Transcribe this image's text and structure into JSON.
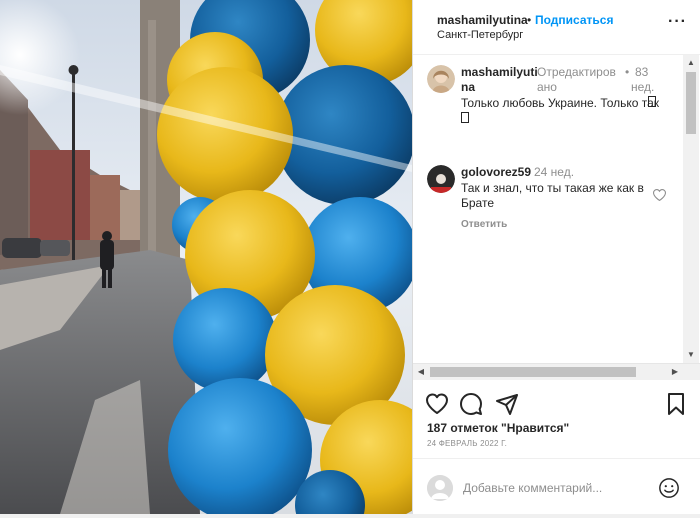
{
  "post": {
    "username": "mashamilyutina",
    "dot": "•",
    "follow_label": "Подписаться",
    "location": "Санкт-Петербург",
    "more_icon": "more-dots-icon"
  },
  "comments": [
    {
      "username_line1": "mashamilyuti",
      "username_line2": "na",
      "edited_line1": "Отредактиров",
      "edited_line2": "ано",
      "dot": "•",
      "age_line1": "83",
      "age_line2": "нед.",
      "text_line1": "Только любовь Украине. Только так",
      "text_line2": "",
      "avatar_icon": "user-avatar-icon"
    },
    {
      "username": "golovorez59",
      "age": "24 нед.",
      "text_line1": "Так и знал, что ты такая же как в",
      "text_line2": "Брате",
      "reply_label": "Ответить",
      "like_icon": "heart-outline-icon",
      "avatar_icon": "user-avatar-icon"
    }
  ],
  "actions": {
    "like_icon": "heart-icon",
    "comment_icon": "comment-icon",
    "share_icon": "share-icon",
    "save_icon": "bookmark-icon"
  },
  "likes_text": "187 отметок \"Нравится\"",
  "date_text": "24 ФЕВРАЛЬ 2022 Г.",
  "add_comment": {
    "placeholder": "Добавьте комментарий...",
    "emoji_icon": "emoji-smile-icon"
  },
  "colors": {
    "accent_blue": "#0095f6",
    "balloon_yellow": "#f2c21b",
    "balloon_blue": "#1f8ed8",
    "text_secondary": "#8e8e8e"
  }
}
